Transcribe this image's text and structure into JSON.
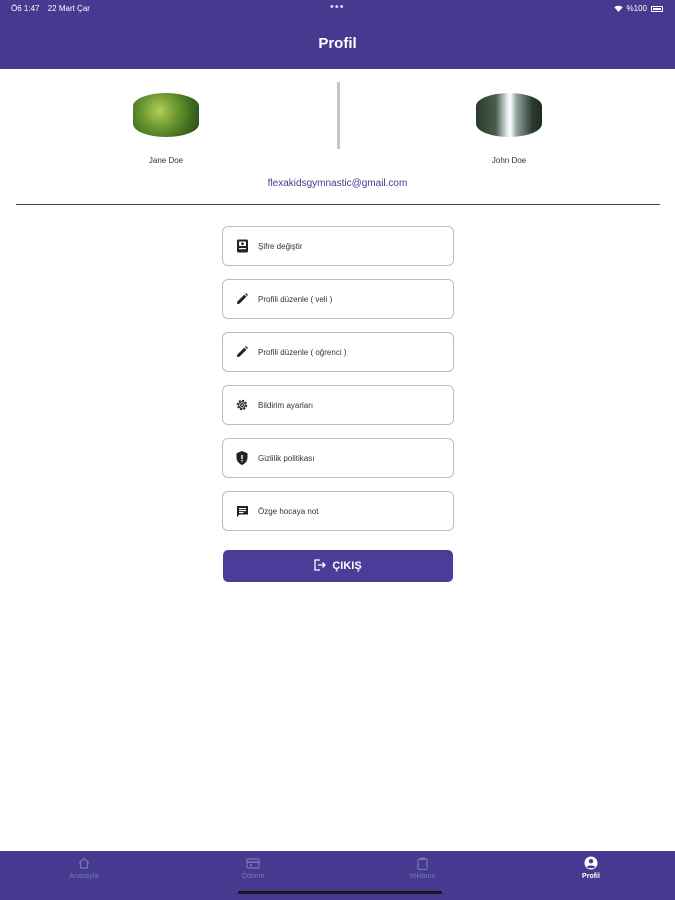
{
  "status_bar": {
    "time": "Ö6 1:47",
    "date": "22 Mart Çar",
    "dots": "•••",
    "battery": "%100"
  },
  "header": {
    "title": "Profil"
  },
  "profiles": {
    "parent": {
      "name": "Jane Doe"
    },
    "child": {
      "name": "John Doe"
    },
    "email": "flexakidsgymnastic@gmail.com"
  },
  "menu": {
    "items": [
      {
        "label": "Şifre değiştir",
        "icon": "book-icon"
      },
      {
        "label": "Profili düzenle ( veli )",
        "icon": "pencil-icon"
      },
      {
        "label": "Profili düzenle ( oğrenci )",
        "icon": "pencil-icon"
      },
      {
        "label": "Bildirim ayarları",
        "icon": "gear-icon"
      },
      {
        "label": "Gizlilik politikası",
        "icon": "shield-icon"
      },
      {
        "label": "Özge hocaya not",
        "icon": "message-icon"
      }
    ]
  },
  "logout": {
    "label": "ÇIKIŞ",
    "icon": "logout-icon"
  },
  "tab_bar": {
    "tabs": [
      {
        "label": "Anasayfa",
        "icon": "home-icon",
        "active": false
      },
      {
        "label": "Ödeme",
        "icon": "payment-icon",
        "active": false
      },
      {
        "label": "Yoklama",
        "icon": "clipboard-icon",
        "active": false
      },
      {
        "label": "Profil",
        "icon": "profile-icon",
        "active": true
      }
    ]
  },
  "colors": {
    "primary": "#453a8f",
    "button": "#4a3c99",
    "inactive_tab": "#7b74b8"
  }
}
